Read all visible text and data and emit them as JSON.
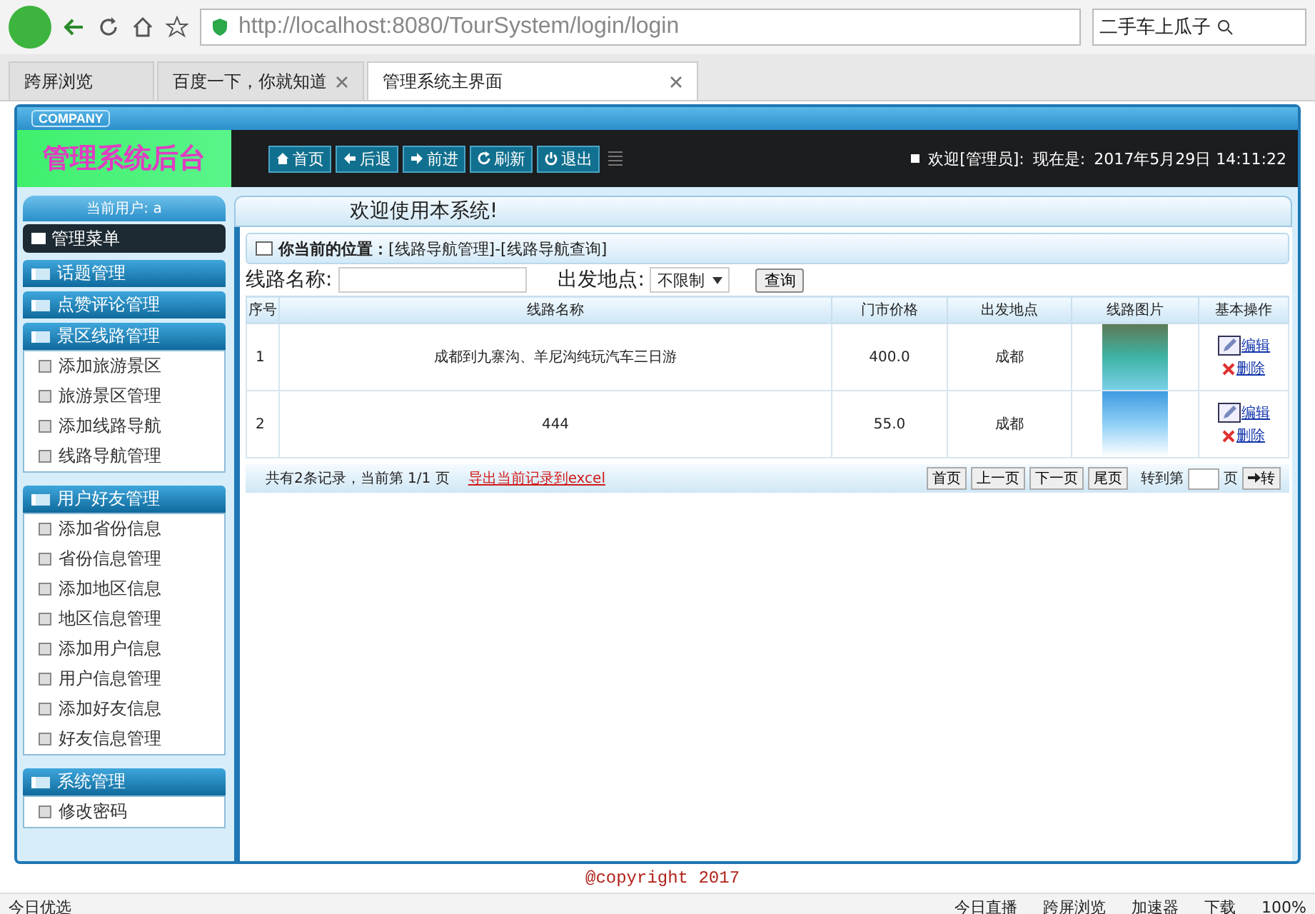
{
  "browser": {
    "url": "http://localhost:8080/TourSystem/login/login",
    "search_text": "二手车上瓜子",
    "tabs": [
      {
        "label": "跨屏浏览",
        "selected": false
      },
      {
        "label": "百度一下，你就知道",
        "selected": false
      },
      {
        "label": "管理系统主界面",
        "selected": true
      }
    ],
    "status_left": "今日优选",
    "status_items": [
      "今日直播",
      "跨屏浏览",
      "加速器",
      "下载"
    ],
    "zoom": "100%"
  },
  "header": {
    "company": "COMPANY",
    "title": "管理系统后台",
    "nav": [
      "首页",
      "后退",
      "前进",
      "刷新",
      "退出"
    ],
    "welcome": "欢迎[管理员]:",
    "now_label": "现在是:",
    "datetime": "2017年5月29日 14:11:22"
  },
  "sidebar": {
    "current_user": "当前用户: a",
    "menu_title": "管理菜单",
    "groups": [
      {
        "label": "话题管理",
        "expanded": false
      },
      {
        "label": "点赞评论管理",
        "expanded": false
      },
      {
        "label": "景区线路管理",
        "expanded": true,
        "items": [
          "添加旅游景区",
          "旅游景区管理",
          "添加线路导航",
          "线路导航管理"
        ]
      },
      {
        "label": "用户好友管理",
        "expanded": true,
        "items": [
          "添加省份信息",
          "省份信息管理",
          "添加地区信息",
          "地区信息管理",
          "添加用户信息",
          "用户信息管理",
          "添加好友信息",
          "好友信息管理"
        ]
      },
      {
        "label": "系统管理",
        "expanded": true,
        "items": [
          "修改密码"
        ]
      }
    ]
  },
  "content": {
    "heading": "欢迎使用本系统!",
    "breadcrumb": "**你当前的位置：**[线路导航管理]-[线路导航查询]",
    "search": {
      "name_label": "线路名称:",
      "depart_label": "出发地点:",
      "depart_value": "不限制",
      "button": "查询"
    },
    "table": {
      "columns": [
        "序号",
        "线路名称",
        "门市价格",
        "出发地点",
        "线路图片",
        "基本操作"
      ],
      "rows": [
        {
          "no": "1",
          "name": "成都到九寨沟、羊尼沟纯玩汽车三日游",
          "price": "400.0",
          "depart": "成都",
          "edit": "编辑",
          "delete": "删除"
        },
        {
          "no": "2",
          "name": "444",
          "price": "55.0",
          "depart": "成都",
          "edit": "编辑",
          "delete": "删除"
        }
      ]
    },
    "pager": {
      "summary": "共有2条记录，当前第 1/1 页",
      "export": "导出当前记录到excel",
      "buttons": [
        "首页",
        "上一页",
        "下一页",
        "尾页"
      ],
      "goto_label": "转到第",
      "page_unit": "页",
      "go": "转"
    }
  },
  "footer": "@copyright 2017"
}
